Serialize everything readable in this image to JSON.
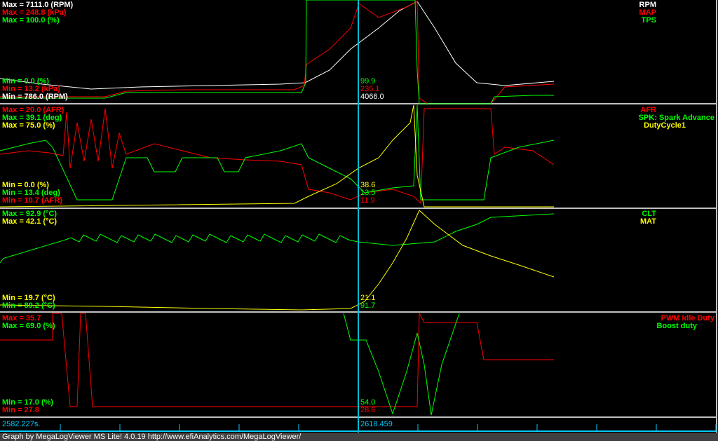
{
  "panels": [
    {
      "max": [
        "Max = 7111.0 (RPM)",
        "Max = 248.8 (kPa)",
        "Max = 100.0 (%)"
      ],
      "min": [
        "Min = 0.0 (%)",
        "Min = 13.2 (kPa)",
        "Min = 786.0 (RPM)"
      ],
      "legend": [
        "RPM",
        "MAP",
        "TPS"
      ],
      "cursor": [
        "99.9",
        "235.1",
        "4066.0"
      ]
    },
    {
      "max": [
        "Max = 20.0 (AFR)",
        "Max = 39.1 (deg)",
        "Max = 75.0 (%)"
      ],
      "min": [
        "Min = 0.0 (%)",
        "Min = 13.4 (deg)",
        "Min = 10.7 (AFR)"
      ],
      "legend": [
        "AFR",
        "SPK: Spark Advance",
        "DutyCycle1"
      ],
      "cursor": [
        "38.6",
        "13.5",
        "11.9"
      ]
    },
    {
      "max": [
        "Max = 92.9 (°C)",
        "Max = 42.1 (°C)"
      ],
      "min": [
        "Min = 19.7 (°C)",
        "Min = 89.2 (°C)"
      ],
      "legend": [
        "CLT",
        "MAT"
      ],
      "cursor": [
        "21.1",
        "91.7"
      ]
    },
    {
      "max": [
        "Max = 35.7",
        "Max = 69.0 (%)"
      ],
      "min": [
        "Min = 17.0 (%)",
        "Min = 27.8"
      ],
      "legend": [
        "PWM Idle Duty",
        "Boost duty"
      ],
      "cursor": [
        "54.0",
        "28.6"
      ]
    }
  ],
  "time": {
    "start": "2582.227s.",
    "cursor": "2618.459"
  },
  "footer": "Graph by MegaLogViewer MS Lite! 4.0.19 http://www.efiAnalytics.com/MegaLogViewer/",
  "colors": {
    "rpm": "#ffffff",
    "map": "#ff0000",
    "tps": "#00ff00",
    "cursor": "#00bcd4"
  }
}
